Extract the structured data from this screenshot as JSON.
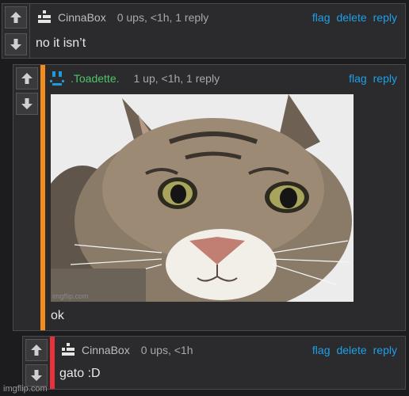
{
  "comments": [
    {
      "username": "CinnaBox",
      "meta": "0 ups, <1h, 1 reply",
      "actions": [
        "flag",
        "delete",
        "reply"
      ],
      "text": "no it isn’t"
    },
    {
      "username": ".Toadette.",
      "meta": "1 up, <1h, 1 reply",
      "actions": [
        "flag",
        "reply"
      ],
      "text": "ok",
      "accent": "#f28c1d",
      "image_watermark": "imgflip.com"
    },
    {
      "username": "CinnaBox",
      "meta": "0 ups, <1h",
      "actions": [
        "flag",
        "delete",
        "reply"
      ],
      "text": "gato :D",
      "accent": "#e8313a"
    }
  ],
  "icons": {
    "upvote": "arrow-up-icon",
    "downvote": "arrow-down-icon"
  },
  "colors": {
    "link": "#1ea0e8",
    "toadette_name": "#4fc36b",
    "background": "#1c1c1e"
  },
  "footer": {
    "watermark": "imgflip.com"
  }
}
